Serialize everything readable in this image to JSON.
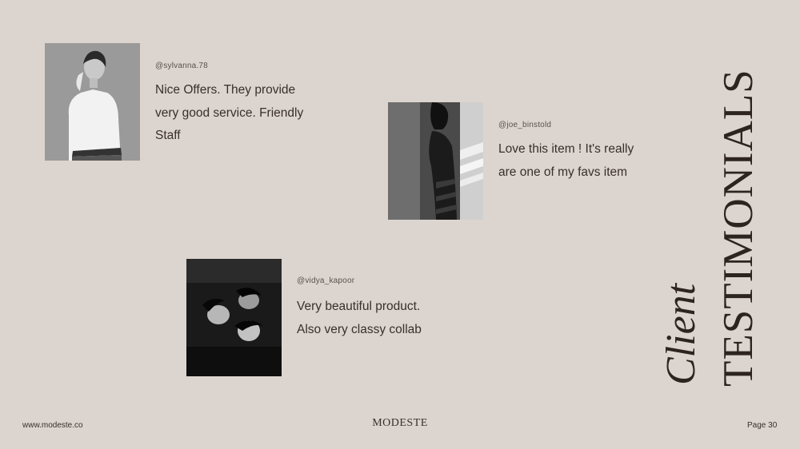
{
  "testimonials": [
    {
      "handle": "@sylvanna.78",
      "lines": [
        "Nice Offers. They provide",
        "very good service. Friendly",
        "Staff"
      ]
    },
    {
      "handle": "@joe_binstold",
      "lines": [
        "Love this item ! It's really",
        "are one of my favs item"
      ]
    },
    {
      "handle": "@vidya_kapoor",
      "lines": [
        "Very beautiful product.",
        "Also very classy collab"
      ]
    }
  ],
  "heading": {
    "script": "Client",
    "main": "TESTIMONIALS"
  },
  "footer": {
    "website": "www.modeste.co",
    "brand": "MODESTE",
    "page": "Page 30"
  },
  "colors": {
    "background": "#dcd4ce",
    "text": "#3a2f2a"
  }
}
